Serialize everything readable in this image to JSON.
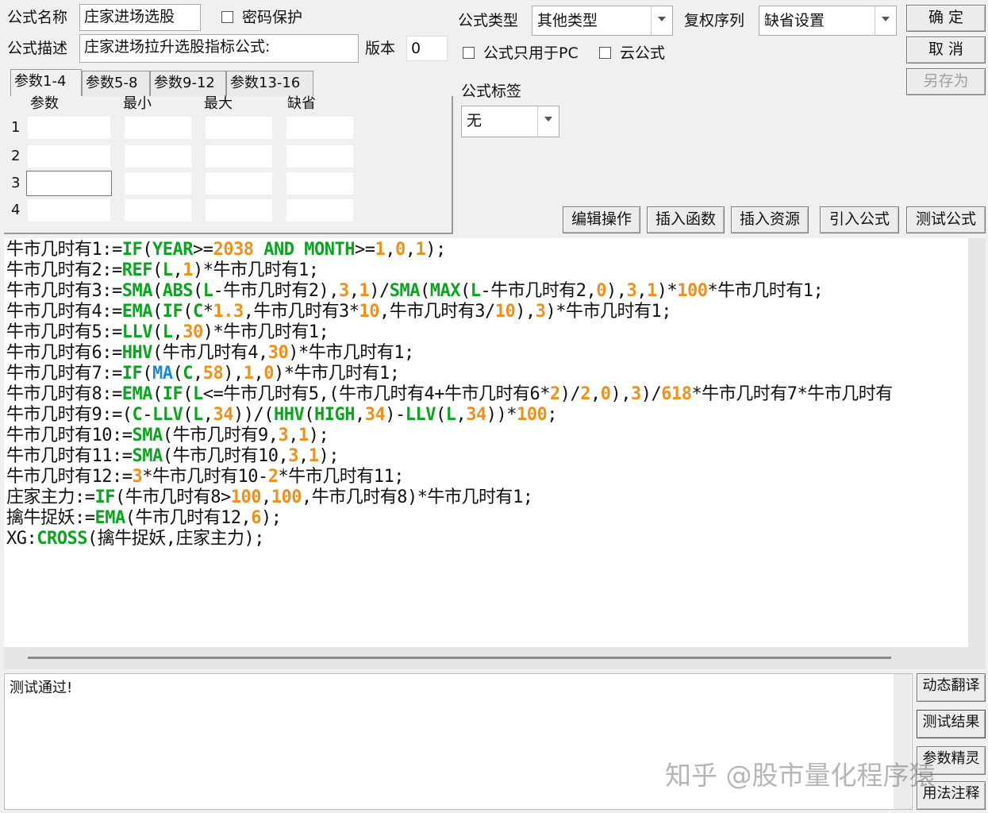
{
  "form": {
    "name_label": "公式名称",
    "name_value": "庄家进场选股",
    "password_label": "密码保护",
    "desc_label": "公式描述",
    "desc_value": "庄家进场拉升选股指标公式:",
    "version_label": "版本",
    "version_value": "0",
    "type_label": "公式类型",
    "type_value": "其他类型",
    "fq_label": "复权序列",
    "fq_value": "缺省设置",
    "pc_only_label": "公式只用于PC",
    "cloud_label": "云公式",
    "tag_label": "公式标签",
    "tag_value": "无"
  },
  "buttons": {
    "ok": "确  定",
    "cancel": "取  消",
    "save_as": "另存为",
    "edit_ops": "编辑操作",
    "insert_func": "插入函数",
    "insert_res": "插入资源",
    "import_formula": "引入公式",
    "test_formula": "测试公式",
    "dyn_translate": "动态翻译",
    "test_result": "测试结果",
    "param_wizard": "参数精灵",
    "usage_notes": "用法注释"
  },
  "params": {
    "tabs": [
      "参数1-4",
      "参数5-8",
      "参数9-12",
      "参数13-16"
    ],
    "headers": [
      "参数",
      "最小",
      "最大",
      "缺省"
    ],
    "rows": [
      "1",
      "2",
      "3",
      "4"
    ]
  },
  "colors": {
    "func": "#0aa41e",
    "num": "#f0901a",
    "ma": "#1a8ad4",
    "text": "#111111"
  },
  "code_lines": [
    [
      [
        "t",
        "牛市几时有1:="
      ],
      [
        "f",
        "IF"
      ],
      [
        "t",
        "("
      ],
      [
        "f",
        "YEAR"
      ],
      [
        "t",
        ">="
      ],
      [
        "n",
        "2038"
      ],
      [
        "t",
        " "
      ],
      [
        "f",
        "AND"
      ],
      [
        "t",
        " "
      ],
      [
        "f",
        "MONTH"
      ],
      [
        "t",
        ">="
      ],
      [
        "n",
        "1"
      ],
      [
        "t",
        ","
      ],
      [
        "n",
        "0"
      ],
      [
        "t",
        ","
      ],
      [
        "n",
        "1"
      ],
      [
        "t",
        ");"
      ]
    ],
    [
      [
        "t",
        "牛市几时有2:="
      ],
      [
        "f",
        "REF"
      ],
      [
        "t",
        "("
      ],
      [
        "f",
        "L"
      ],
      [
        "t",
        ","
      ],
      [
        "n",
        "1"
      ],
      [
        "t",
        ")*牛市几时有1;"
      ]
    ],
    [
      [
        "t",
        "牛市几时有3:="
      ],
      [
        "f",
        "SMA"
      ],
      [
        "t",
        "("
      ],
      [
        "f",
        "ABS"
      ],
      [
        "t",
        "("
      ],
      [
        "f",
        "L"
      ],
      [
        "t",
        "-牛市几时有2),"
      ],
      [
        "n",
        "3"
      ],
      [
        "t",
        ","
      ],
      [
        "n",
        "1"
      ],
      [
        "t",
        ")/"
      ],
      [
        "f",
        "SMA"
      ],
      [
        "t",
        "("
      ],
      [
        "f",
        "MAX"
      ],
      [
        "t",
        "("
      ],
      [
        "f",
        "L"
      ],
      [
        "t",
        "-牛市几时有2,"
      ],
      [
        "n",
        "0"
      ],
      [
        "t",
        "),"
      ],
      [
        "n",
        "3"
      ],
      [
        "t",
        ","
      ],
      [
        "n",
        "1"
      ],
      [
        "t",
        ")*"
      ],
      [
        "n",
        "100"
      ],
      [
        "t",
        "*牛市几时有1;"
      ]
    ],
    [
      [
        "t",
        "牛市几时有4:="
      ],
      [
        "f",
        "EMA"
      ],
      [
        "t",
        "("
      ],
      [
        "f",
        "IF"
      ],
      [
        "t",
        "("
      ],
      [
        "f",
        "C"
      ],
      [
        "t",
        "*"
      ],
      [
        "n",
        "1.3"
      ],
      [
        "t",
        ",牛市几时有3*"
      ],
      [
        "n",
        "10"
      ],
      [
        "t",
        ",牛市几时有3/"
      ],
      [
        "n",
        "10"
      ],
      [
        "t",
        "),"
      ],
      [
        "n",
        "3"
      ],
      [
        "t",
        ")*牛市几时有1;"
      ]
    ],
    [
      [
        "t",
        "牛市几时有5:="
      ],
      [
        "f",
        "LLV"
      ],
      [
        "t",
        "("
      ],
      [
        "f",
        "L"
      ],
      [
        "t",
        ","
      ],
      [
        "n",
        "30"
      ],
      [
        "t",
        ")*牛市几时有1;"
      ]
    ],
    [
      [
        "t",
        "牛市几时有6:="
      ],
      [
        "f",
        "HHV"
      ],
      [
        "t",
        "(牛市几时有4,"
      ],
      [
        "n",
        "30"
      ],
      [
        "t",
        ")*牛市几时有1;"
      ]
    ],
    [
      [
        "t",
        "牛市几时有7:="
      ],
      [
        "f",
        "IF"
      ],
      [
        "t",
        "("
      ],
      [
        "m",
        "MA"
      ],
      [
        "t",
        "("
      ],
      [
        "f",
        "C"
      ],
      [
        "t",
        ","
      ],
      [
        "n",
        "58"
      ],
      [
        "t",
        "),"
      ],
      [
        "n",
        "1"
      ],
      [
        "t",
        ","
      ],
      [
        "n",
        "0"
      ],
      [
        "t",
        ")*牛市几时有1;"
      ]
    ],
    [
      [
        "t",
        "牛市几时有8:="
      ],
      [
        "f",
        "EMA"
      ],
      [
        "t",
        "("
      ],
      [
        "f",
        "IF"
      ],
      [
        "t",
        "("
      ],
      [
        "f",
        "L"
      ],
      [
        "t",
        "<=牛市几时有5,(牛市几时有4+牛市几时有6*"
      ],
      [
        "n",
        "2"
      ],
      [
        "t",
        ")/"
      ],
      [
        "n",
        "2"
      ],
      [
        "t",
        ","
      ],
      [
        "n",
        "0"
      ],
      [
        "t",
        "),"
      ],
      [
        "n",
        "3"
      ],
      [
        "t",
        ")/"
      ],
      [
        "n",
        "618"
      ],
      [
        "t",
        "*牛市几时有7*牛市几时有"
      ]
    ],
    [
      [
        "t",
        "牛市几时有9:=("
      ],
      [
        "f",
        "C"
      ],
      [
        "t",
        "-"
      ],
      [
        "f",
        "LLV"
      ],
      [
        "t",
        "("
      ],
      [
        "f",
        "L"
      ],
      [
        "t",
        ","
      ],
      [
        "n",
        "34"
      ],
      [
        "t",
        "))/("
      ],
      [
        "f",
        "HHV"
      ],
      [
        "t",
        "("
      ],
      [
        "f",
        "HIGH"
      ],
      [
        "t",
        ","
      ],
      [
        "n",
        "34"
      ],
      [
        "t",
        ")-"
      ],
      [
        "f",
        "LLV"
      ],
      [
        "t",
        "("
      ],
      [
        "f",
        "L"
      ],
      [
        "t",
        ","
      ],
      [
        "n",
        "34"
      ],
      [
        "t",
        "))*"
      ],
      [
        "n",
        "100"
      ],
      [
        "t",
        ";"
      ]
    ],
    [
      [
        "t",
        "牛市几时有10:="
      ],
      [
        "f",
        "SMA"
      ],
      [
        "t",
        "(牛市几时有9,"
      ],
      [
        "n",
        "3"
      ],
      [
        "t",
        ","
      ],
      [
        "n",
        "1"
      ],
      [
        "t",
        ");"
      ]
    ],
    [
      [
        "t",
        "牛市几时有11:="
      ],
      [
        "f",
        "SMA"
      ],
      [
        "t",
        "(牛市几时有10,"
      ],
      [
        "n",
        "3"
      ],
      [
        "t",
        ","
      ],
      [
        "n",
        "1"
      ],
      [
        "t",
        ");"
      ]
    ],
    [
      [
        "t",
        "牛市几时有12:="
      ],
      [
        "n",
        "3"
      ],
      [
        "t",
        "*牛市几时有10-"
      ],
      [
        "n",
        "2"
      ],
      [
        "t",
        "*牛市几时有11;"
      ]
    ],
    [
      [
        "t",
        "庄家主力:="
      ],
      [
        "f",
        "IF"
      ],
      [
        "t",
        "(牛市几时有8>"
      ],
      [
        "n",
        "100"
      ],
      [
        "t",
        ","
      ],
      [
        "n",
        "100"
      ],
      [
        "t",
        ",牛市几时有8)*牛市几时有1;"
      ]
    ],
    [
      [
        "t",
        "擒牛捉妖:="
      ],
      [
        "f",
        "EMA"
      ],
      [
        "t",
        "(牛市几时有12,"
      ],
      [
        "n",
        "6"
      ],
      [
        "t",
        ");"
      ]
    ],
    [
      [
        "t",
        "XG:"
      ],
      [
        "f",
        "CROSS"
      ],
      [
        "t",
        "(擒牛捉妖,庄家主力);"
      ]
    ]
  ],
  "output": {
    "message": "测试通过!"
  },
  "watermark": "知乎 @股市量化程序猿"
}
